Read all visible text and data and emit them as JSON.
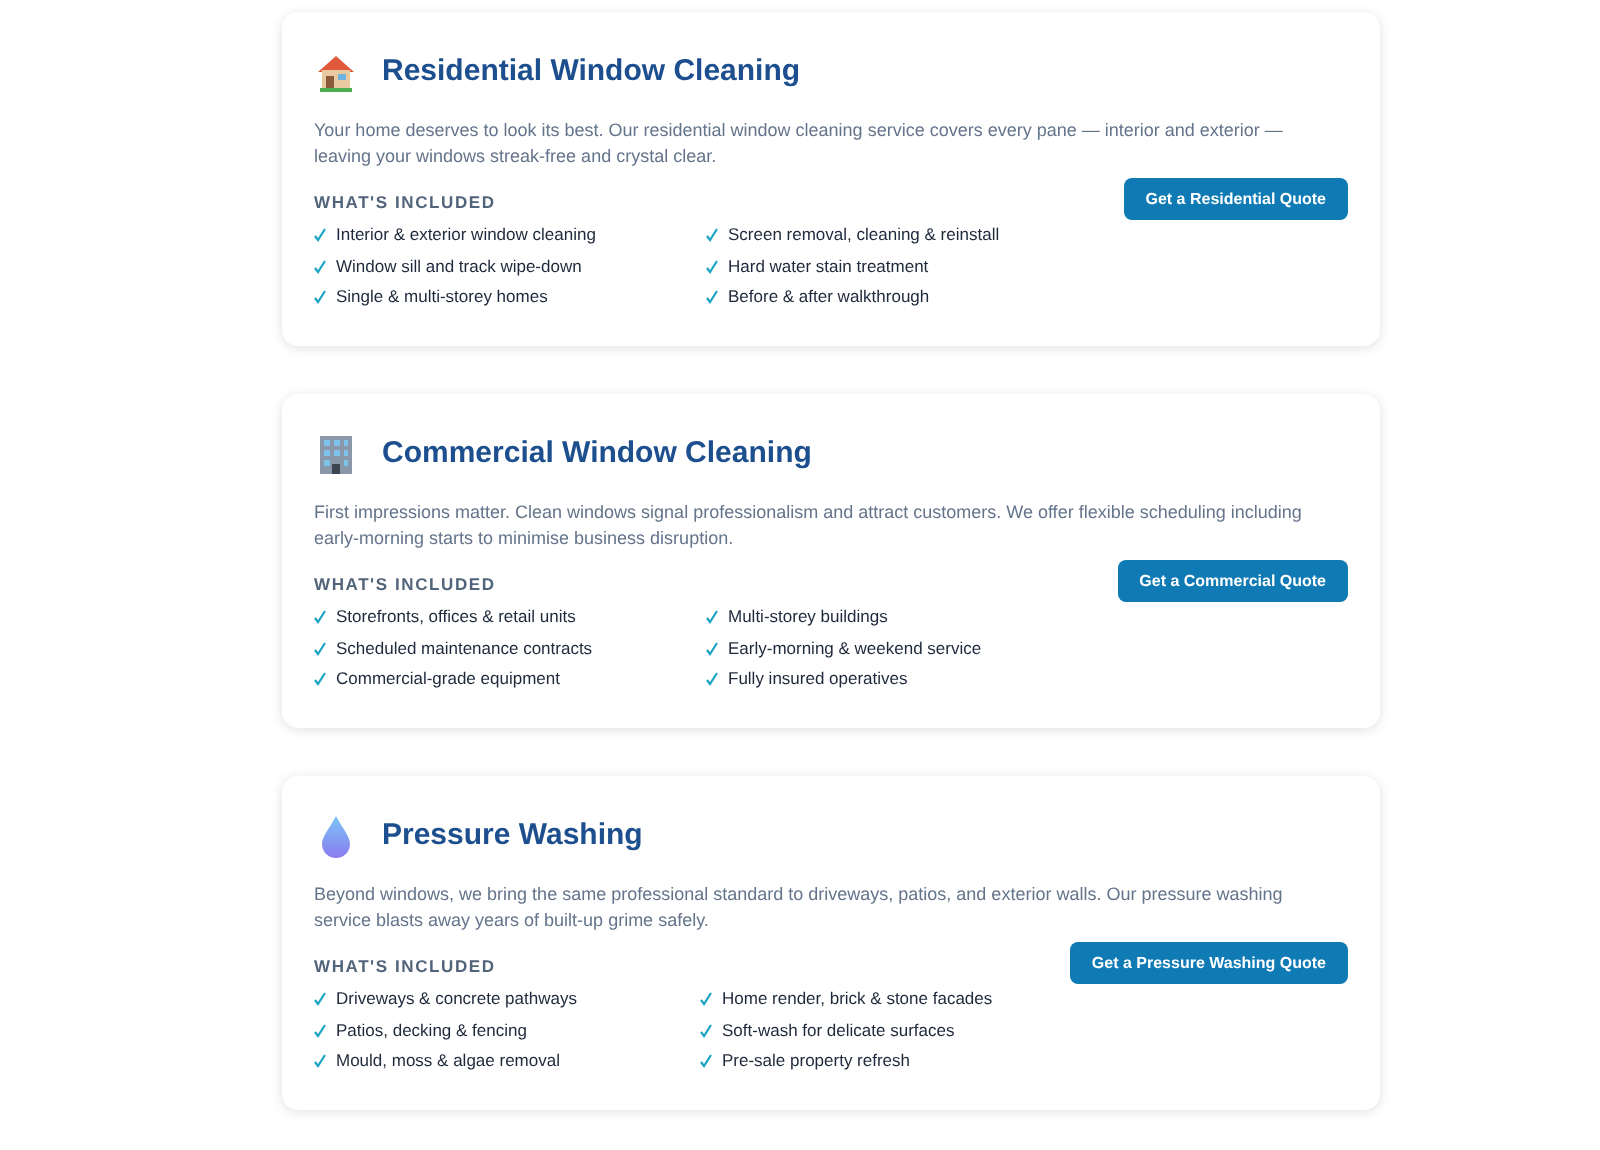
{
  "services": [
    {
      "kind": "house",
      "title": "Residential Window Cleaning",
      "description": "Your home deserves to look its best. Our residential window cleaning service covers every pane — interior and exterior — leaving your windows streak-free and crystal clear.",
      "included_heading": "WHAT'S INCLUDED",
      "items": [
        "Interior & exterior window cleaning",
        "Screen removal, cleaning & reinstall",
        "Window sill and track wipe-down",
        "Hard water stain treatment",
        "Single & multi-storey homes",
        "Before & after walkthrough"
      ],
      "button": "Get a Residential Quote"
    },
    {
      "kind": "building",
      "title": "Commercial Window Cleaning",
      "description": "First impressions matter. Clean windows signal professionalism and attract customers. We offer flexible scheduling including early-morning starts to minimise business disruption.",
      "included_heading": "WHAT'S INCLUDED",
      "items": [
        "Storefronts, offices & retail units",
        "Multi-storey buildings",
        "Scheduled maintenance contracts",
        "Early-morning & weekend service",
        "Commercial-grade equipment",
        "Fully insured operatives"
      ],
      "button": "Get a Commercial Quote"
    },
    {
      "kind": "drop",
      "title": "Pressure Washing",
      "description": "Beyond windows, we bring the same professional standard to driveways, patios, and exterior walls. Our pressure washing service blasts away years of built-up grime safely.",
      "included_heading": "WHAT'S INCLUDED",
      "items": [
        "Driveways & concrete pathways",
        "Home render, brick & stone facades",
        "Patios, decking & fencing",
        "Soft-wash for delicate surfaces",
        "Mould, moss & algae removal",
        "Pre-sale property refresh"
      ],
      "button": "Get a Pressure Washing Quote"
    }
  ]
}
